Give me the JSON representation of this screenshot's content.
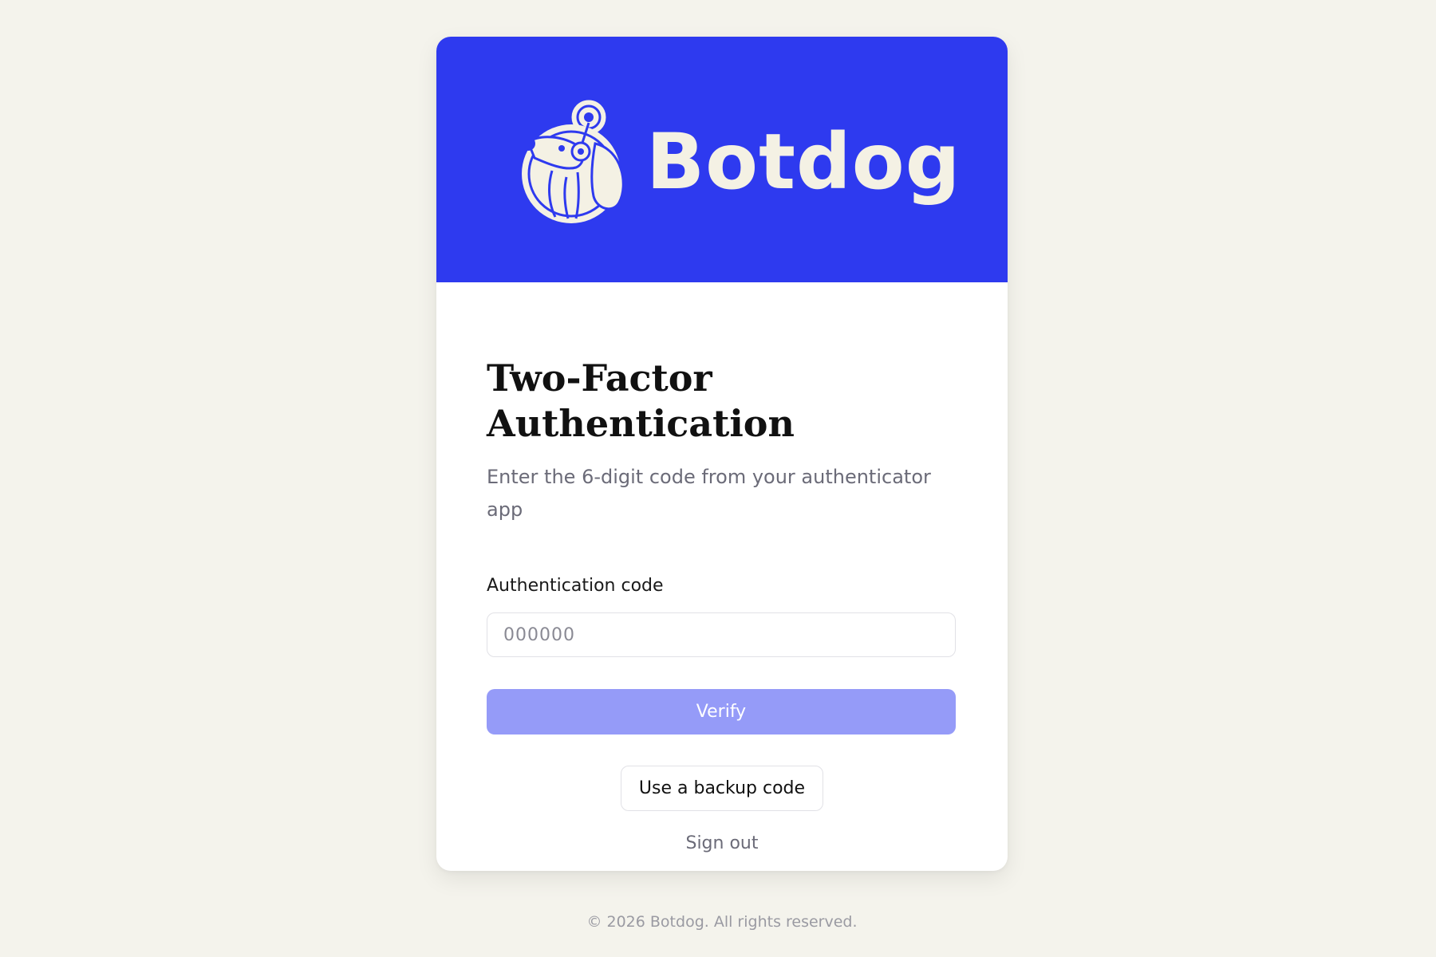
{
  "brand": {
    "name": "Botdog",
    "header_color": "#2e3aef",
    "logo_icon": "dog-mascot-icon"
  },
  "auth": {
    "title": "Two-Factor Authentication",
    "subtitle": "Enter the 6-digit code from your authenticator app",
    "field_label": "Authentication code",
    "code_value": "",
    "code_placeholder": "000000",
    "verify_label": "Verify",
    "backup_label": "Use a backup code",
    "signout_label": "Sign out"
  },
  "footer": {
    "text": "© 2026 Botdog. All rights reserved."
  },
  "colors": {
    "page_background": "#f4f3ec",
    "accent": "#2e3aef",
    "verify_button": "#959bf8",
    "logo_foreground": "#f4f1e4"
  }
}
